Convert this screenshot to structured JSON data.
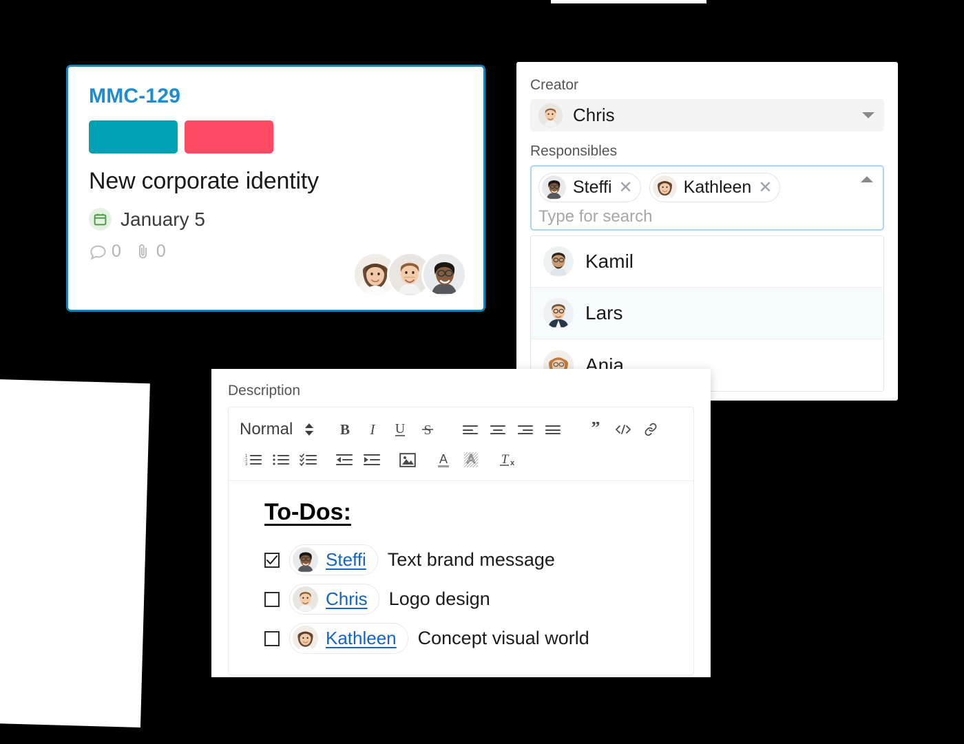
{
  "card": {
    "id": "MMC-129",
    "title": "New corporate identity",
    "labels": [
      {
        "name": "teal-label",
        "color": "#00a0b5"
      },
      {
        "name": "red-label",
        "color": "#ff4a63"
      }
    ],
    "due_date": "January 5",
    "date_icon": "calendar-icon",
    "comments_icon": "comment-icon",
    "comments_count": "0",
    "attachments_icon": "attachment-icon",
    "attachments_count": "0",
    "assignees": [
      "Kathleen",
      "Chris",
      "Steffi"
    ],
    "accent_border_color": "#1b7fb8",
    "id_color": "#1f8ccf"
  },
  "people_panel": {
    "creator": {
      "label": "Creator",
      "value": "Chris",
      "caret_icon": "chevron-down-icon"
    },
    "responsibles": {
      "label": "Responsibles",
      "selected": [
        {
          "name": "Steffi",
          "remove_icon": "close-icon"
        },
        {
          "name": "Kathleen",
          "remove_icon": "close-icon"
        }
      ],
      "search_placeholder": "Type for search",
      "search_value": "",
      "collapse_icon": "chevron-up-icon",
      "options": [
        {
          "name": "Kamil",
          "highlighted": false
        },
        {
          "name": "Lars",
          "highlighted": true
        },
        {
          "name": "Anja",
          "highlighted": false
        }
      ]
    }
  },
  "description": {
    "label": "Description",
    "toolbar": {
      "format_label": "Normal",
      "format_stepper_icon": "updown-arrows-icon",
      "row1": [
        {
          "name": "bold-button",
          "icon": "bold-icon"
        },
        {
          "name": "italic-button",
          "icon": "italic-icon"
        },
        {
          "name": "underline-button",
          "icon": "underline-icon"
        },
        {
          "name": "strikethrough-button",
          "icon": "strikethrough-icon"
        },
        {
          "name": "align-left-button",
          "icon": "align-left-icon"
        },
        {
          "name": "align-center-button",
          "icon": "align-center-icon"
        },
        {
          "name": "align-right-button",
          "icon": "align-right-icon"
        },
        {
          "name": "align-justify-button",
          "icon": "align-justify-icon"
        },
        {
          "name": "blockquote-button",
          "icon": "quote-icon"
        },
        {
          "name": "code-block-button",
          "icon": "code-icon"
        },
        {
          "name": "link-button",
          "icon": "link-icon"
        }
      ],
      "row2": [
        {
          "name": "ordered-list-button",
          "icon": "ordered-list-icon"
        },
        {
          "name": "bullet-list-button",
          "icon": "bullet-list-icon"
        },
        {
          "name": "check-list-button",
          "icon": "check-list-icon"
        },
        {
          "name": "outdent-button",
          "icon": "outdent-icon"
        },
        {
          "name": "indent-button",
          "icon": "indent-icon"
        },
        {
          "name": "insert-image-button",
          "icon": "image-icon"
        },
        {
          "name": "text-color-button",
          "icon": "text-color-icon"
        },
        {
          "name": "background-color-button",
          "icon": "background-color-icon"
        },
        {
          "name": "clear-format-button",
          "icon": "clear-format-icon"
        }
      ]
    },
    "content": {
      "heading": "To-Dos:",
      "todos": [
        {
          "checked": true,
          "mention": "Steffi",
          "text": "Text brand message"
        },
        {
          "checked": false,
          "mention": "Chris",
          "text": "Logo design"
        },
        {
          "checked": false,
          "mention": "Kathleen",
          "text": "Concept visual world"
        }
      ]
    }
  }
}
